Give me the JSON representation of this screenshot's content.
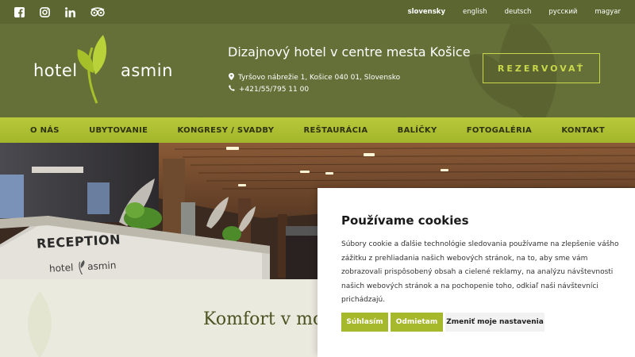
{
  "topbar": {
    "social": [
      "facebook-icon",
      "instagram-icon",
      "linkedin-icon",
      "tripadvisor-icon"
    ],
    "languages": [
      {
        "label": "slovensky",
        "active": true
      },
      {
        "label": "english",
        "active": false
      },
      {
        "label": "deutsch",
        "active": false
      },
      {
        "label": "русский",
        "active": false
      },
      {
        "label": "magyar",
        "active": false
      }
    ]
  },
  "header": {
    "logo_left": "hotel",
    "logo_right": "asmin",
    "tagline": "Dizajnový hotel v centre mesta Košice",
    "address": "Tyršovo nábrežie 1, Košice 040 01, Slovensko",
    "phone": "+421/55/795 11 00",
    "reserve_label": "REZERVOVAŤ"
  },
  "nav": {
    "items": [
      "O NÁS",
      "UBYTOVANIE",
      "KONGRESY / SVADBY",
      "REŠTAURÁCIA",
      "BALÍČKY",
      "FOTOGALÉRIA",
      "KONTAKT"
    ]
  },
  "hero": {
    "reception_sign": "RECEPTION",
    "desk_logo_left": "hotel",
    "desk_logo_right": "asmin"
  },
  "content": {
    "title": "Komfort v mo"
  },
  "cookie": {
    "title": "Používame cookies",
    "text": "Súbory cookie a ďalšie technológie sledovania používame na zlepšenie vášho zážitku z prehliadania našich webových stránok, na to, aby sme vám zobrazovali prispôsobený obsah a cielené reklamy, na analýzu návštevnosti našich webových stránok a na pochopenie toho, odkiaľ naši návštevníci prichádzajú.",
    "accept_label": "Súhlasím",
    "reject_label": "Odmietam",
    "settings_label": "Zmeniť moje nastavenia"
  },
  "colors": {
    "topbar": "#5b6630",
    "header": "#656f38",
    "accent_green": "#a6b82b",
    "nav_text": "#2d3313"
  }
}
